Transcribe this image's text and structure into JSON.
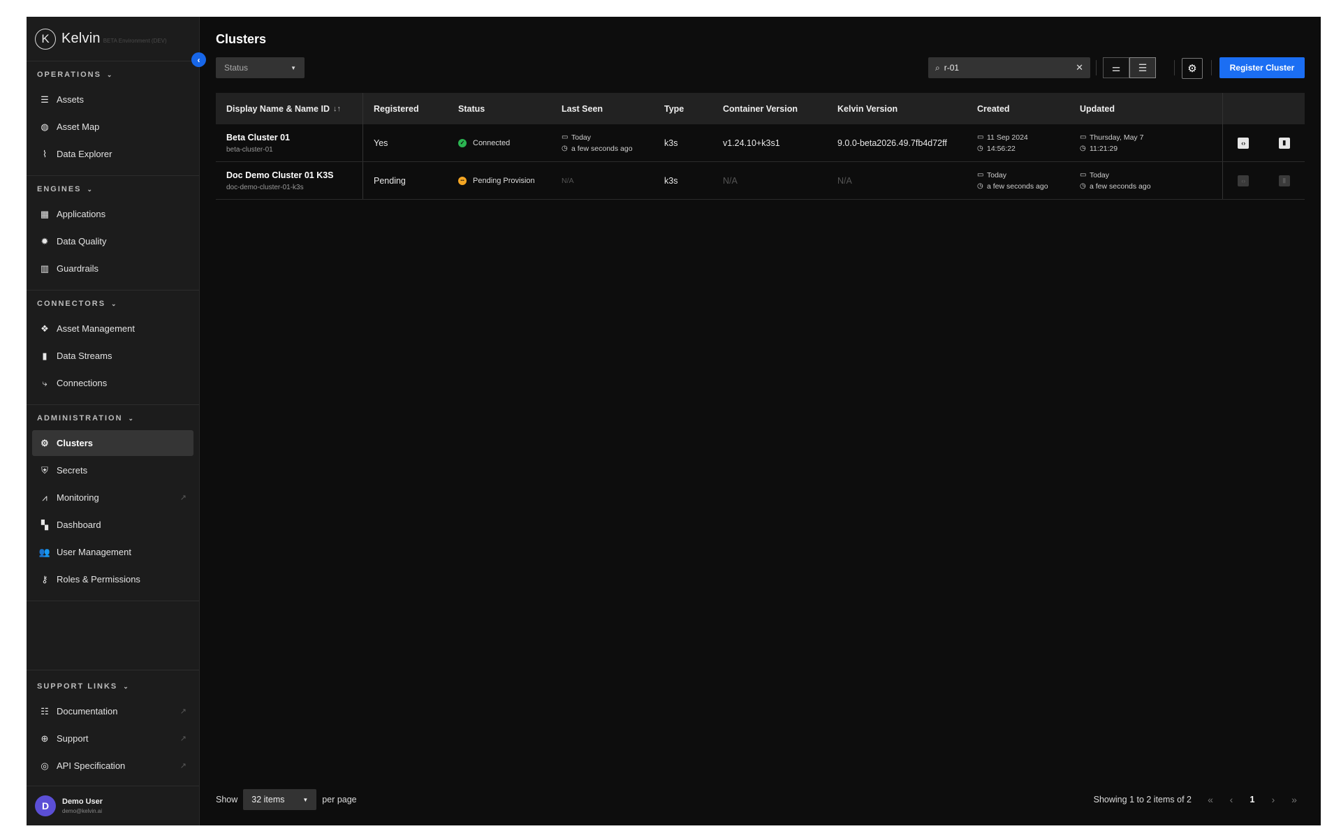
{
  "app": {
    "name": "Kelvin",
    "env": "BETA Environment (DEV)",
    "logo_letter": "K"
  },
  "sidebar": {
    "sections": [
      {
        "title": "OPERATIONS",
        "items": [
          {
            "label": "Assets",
            "icon": "assets-icon",
            "glyph": "☰"
          },
          {
            "label": "Asset Map",
            "icon": "globe-icon",
            "glyph": "◍"
          },
          {
            "label": "Data Explorer",
            "icon": "pulse-icon",
            "glyph": "⌇"
          }
        ]
      },
      {
        "title": "ENGINES",
        "items": [
          {
            "label": "Applications",
            "icon": "apps-icon",
            "glyph": "▦"
          },
          {
            "label": "Data Quality",
            "icon": "gear-icon",
            "glyph": "✹"
          },
          {
            "label": "Guardrails",
            "icon": "guardrail-icon",
            "glyph": "▥"
          }
        ]
      },
      {
        "title": "CONNECTORS",
        "items": [
          {
            "label": "Asset Management",
            "icon": "asset-management-icon",
            "glyph": "❖"
          },
          {
            "label": "Data Streams",
            "icon": "bar-chart-icon",
            "glyph": "▮"
          },
          {
            "label": "Connections",
            "icon": "connections-icon",
            "glyph": "⤷"
          }
        ]
      },
      {
        "title": "ADMINISTRATION",
        "items": [
          {
            "label": "Clusters",
            "icon": "clusters-icon",
            "glyph": "⚙",
            "active": true
          },
          {
            "label": "Secrets",
            "icon": "shield-icon",
            "glyph": "⛨"
          },
          {
            "label": "Monitoring",
            "icon": "monitoring-icon",
            "glyph": "⩘",
            "external": true
          },
          {
            "label": "Dashboard",
            "icon": "dashboard-icon",
            "glyph": "▚"
          },
          {
            "label": "User Management",
            "icon": "users-icon",
            "glyph": "👥"
          },
          {
            "label": "Roles & Permissions",
            "icon": "roles-icon",
            "glyph": "⚷"
          }
        ]
      }
    ],
    "support": {
      "title": "SUPPORT LINKS",
      "items": [
        {
          "label": "Documentation",
          "icon": "document-icon",
          "glyph": "☷",
          "external": true
        },
        {
          "label": "Support",
          "icon": "lifebuoy-icon",
          "glyph": "⊕",
          "external": true
        },
        {
          "label": "API Specification",
          "icon": "api-icon",
          "glyph": "◎",
          "external": true
        }
      ]
    },
    "user": {
      "initial": "D",
      "name": "Demo User",
      "email": "demo@kelvin.ai"
    }
  },
  "main": {
    "title": "Clusters",
    "status_filter": "Status",
    "search_value": "r-01",
    "register_label": "Register Cluster",
    "columns": [
      "Display Name & Name ID",
      "Registered",
      "Status",
      "Last Seen",
      "Type",
      "Container Version",
      "Kelvin Version",
      "Created",
      "Updated"
    ],
    "rows": [
      {
        "name": "Beta Cluster 01",
        "name_id": "beta-cluster-01",
        "registered": "Yes",
        "status": "Connected",
        "status_kind": "ok",
        "last_seen": {
          "date": "Today",
          "time": "a few seconds ago"
        },
        "type": "k3s",
        "container_version": "v1.24.10+k3s1",
        "kelvin_version": "9.0.0-beta2026.49.7fb4d72ff",
        "created": {
          "date": "11 Sep 2024",
          "time": "14:56:22"
        },
        "updated": {
          "date": "Thursday, May 7",
          "time": "11:21:29"
        }
      },
      {
        "name": "Doc Demo Cluster 01 K3S",
        "name_id": "doc-demo-cluster-01-k3s",
        "registered": "Pending",
        "status": "Pending Provision",
        "status_kind": "pending",
        "last_seen": {
          "na": "N/A"
        },
        "type": "k3s",
        "container_version": "N/A",
        "kelvin_version": "N/A",
        "created": {
          "date": "Today",
          "time": "a few seconds ago"
        },
        "updated": {
          "date": "Today",
          "time": "a few seconds ago"
        }
      }
    ],
    "footer": {
      "show": "Show",
      "per_page_value": "32 items",
      "per_page": "per page",
      "showing": "Showing 1 to 2 items of 2",
      "current_page": "1"
    }
  }
}
